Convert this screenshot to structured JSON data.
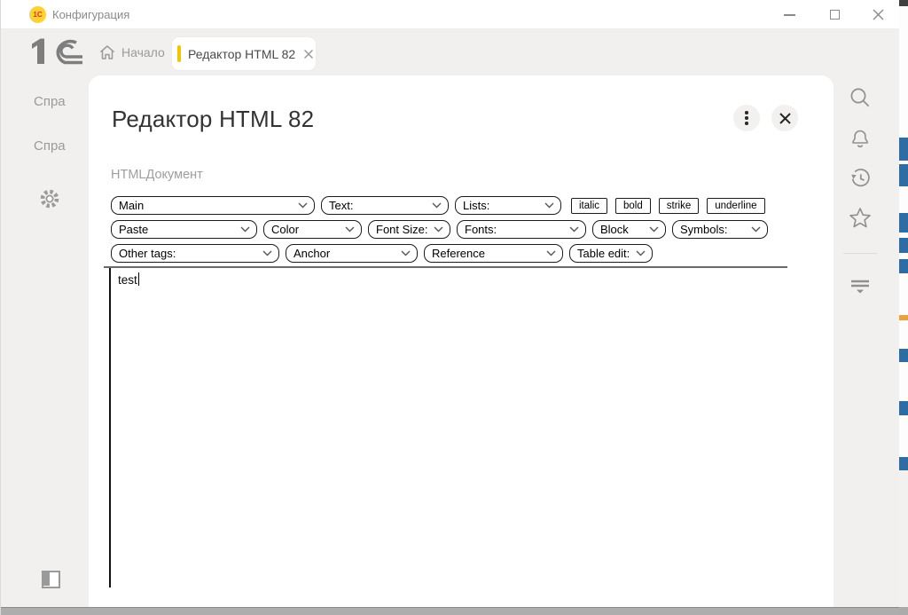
{
  "window": {
    "title": "Конфигурация"
  },
  "tab_bar": {
    "home_label": "Начало",
    "active_tab": {
      "label": "Редактор HTML 82"
    }
  },
  "left_sidebar": {
    "items": [
      {
        "label": "Спра"
      },
      {
        "label": "Спра"
      }
    ]
  },
  "panel": {
    "title": "Редактор HTML 82",
    "field_label": "HTMLДокумент"
  },
  "toolbar": {
    "row1": [
      {
        "label": "Main"
      },
      {
        "label": "Text:"
      },
      {
        "label": "Lists:"
      }
    ],
    "format_buttons": [
      {
        "label": "italic"
      },
      {
        "label": "bold"
      },
      {
        "label": "strike"
      },
      {
        "label": "underline"
      }
    ],
    "row2": [
      {
        "label": "Paste"
      },
      {
        "label": "Color"
      },
      {
        "label": "Font Size:"
      },
      {
        "label": "Fonts:"
      },
      {
        "label": "Block"
      },
      {
        "label": "Symbols:"
      }
    ],
    "row3": [
      {
        "label": "Other tags:"
      },
      {
        "label": "Anchor"
      },
      {
        "label": "Reference"
      },
      {
        "label": "Table edit:"
      }
    ]
  },
  "editor": {
    "content": "test"
  },
  "icons": {
    "right_sidebar": [
      "search",
      "bell",
      "history",
      "star",
      "filter"
    ]
  },
  "colors": {
    "accent_yellow": "#f5c400",
    "selection_blue": "#2e6da4",
    "icon_gray": "#8f8f8f"
  }
}
